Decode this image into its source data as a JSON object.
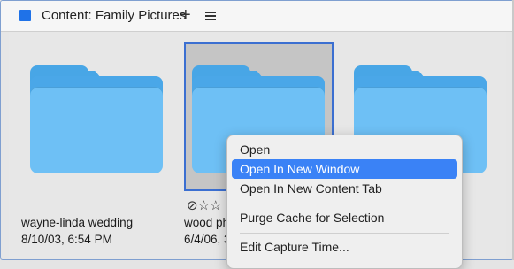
{
  "window": {
    "title": "Content: Family Pictures",
    "add_tab_glyph": "+",
    "menu_icon": "hamburger-icon",
    "accent_color": "#1f72e8"
  },
  "items": [
    {
      "name": "wayne-linda wedding",
      "date": "8/10/03, 6:54 PM",
      "icon": "folder-icon",
      "selected": false
    },
    {
      "name": "wood ph",
      "date": "6/4/06, 3",
      "icon": "folder-icon",
      "selected": true
    },
    {
      "name": "",
      "date": "",
      "icon": "folder-icon",
      "selected": false
    }
  ],
  "rating": {
    "reject_glyph": "⊘",
    "stars": "☆☆",
    "value": 0
  },
  "context_menu": {
    "items": [
      {
        "label": "Open",
        "highlighted": false
      },
      {
        "label": "Open In New Window",
        "highlighted": true
      },
      {
        "label": "Open In New Content Tab",
        "highlighted": false
      },
      {
        "label": "Purge Cache for Selection",
        "highlighted": false
      },
      {
        "label": "Edit Capture Time...",
        "highlighted": false
      }
    ],
    "highlight_color": "#3a82f6"
  }
}
